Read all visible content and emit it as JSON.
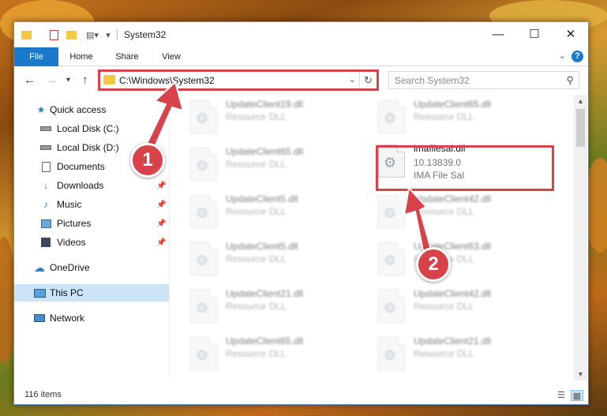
{
  "window": {
    "title": "System32",
    "controls": {
      "minimize": "—",
      "maximize": "☐",
      "close": "✕"
    }
  },
  "ribbon": {
    "tabs": [
      "File",
      "Home",
      "Share",
      "View"
    ],
    "help": "?"
  },
  "address": {
    "path": "C:\\Windows\\System32",
    "search_placeholder": "Search System32"
  },
  "sidebar": {
    "items": [
      {
        "label": "Quick access",
        "icon": "star-icon"
      },
      {
        "label": "Local Disk (C:)",
        "icon": "drive-icon"
      },
      {
        "label": "Local Disk (D:)",
        "icon": "drive-icon"
      },
      {
        "label": "Documents",
        "icon": "documents-icon"
      },
      {
        "label": "Downloads",
        "icon": "download-icon"
      },
      {
        "label": "Music",
        "icon": "music-icon"
      },
      {
        "label": "Pictures",
        "icon": "pictures-icon"
      },
      {
        "label": "Videos",
        "icon": "videos-icon"
      },
      {
        "label": "OneDrive",
        "icon": "cloud-icon"
      },
      {
        "label": "This PC",
        "icon": "computer-icon"
      },
      {
        "label": "Network",
        "icon": "network-icon"
      }
    ]
  },
  "files": [
    {
      "name": "UpdateClient19.dll",
      "desc": "Resource DLL"
    },
    {
      "name": "UpdateClient65.dll",
      "desc": "Resource DLL"
    },
    {
      "name": "UpdateClient65.dll",
      "desc": "Resource DLL"
    },
    {
      "name": "imafilesal.dll",
      "desc": "10.13839.0",
      "desc2": "IMA File Sal"
    },
    {
      "name": "UpdateClient5.dll",
      "desc": "Resource DLL"
    },
    {
      "name": "UpdateClient42.dll",
      "desc": "Resource DLL"
    },
    {
      "name": "UpdateClient5.dll",
      "desc": "Resource DLL"
    },
    {
      "name": "UpdateClient63.dll",
      "desc": "Resource DLL"
    },
    {
      "name": "UpdateClient21.dll",
      "desc": "Resource DLL"
    },
    {
      "name": "UpdateClient42.dll",
      "desc": "Resource DLL"
    },
    {
      "name": "UpdateClient65.dll",
      "desc": "Resource DLL"
    },
    {
      "name": "UpdateClient21.dll",
      "desc": "Resource DLL"
    }
  ],
  "status": {
    "count": "116 items"
  },
  "annotations": {
    "step1": "1",
    "step2": "2",
    "color": "#d8434a"
  }
}
